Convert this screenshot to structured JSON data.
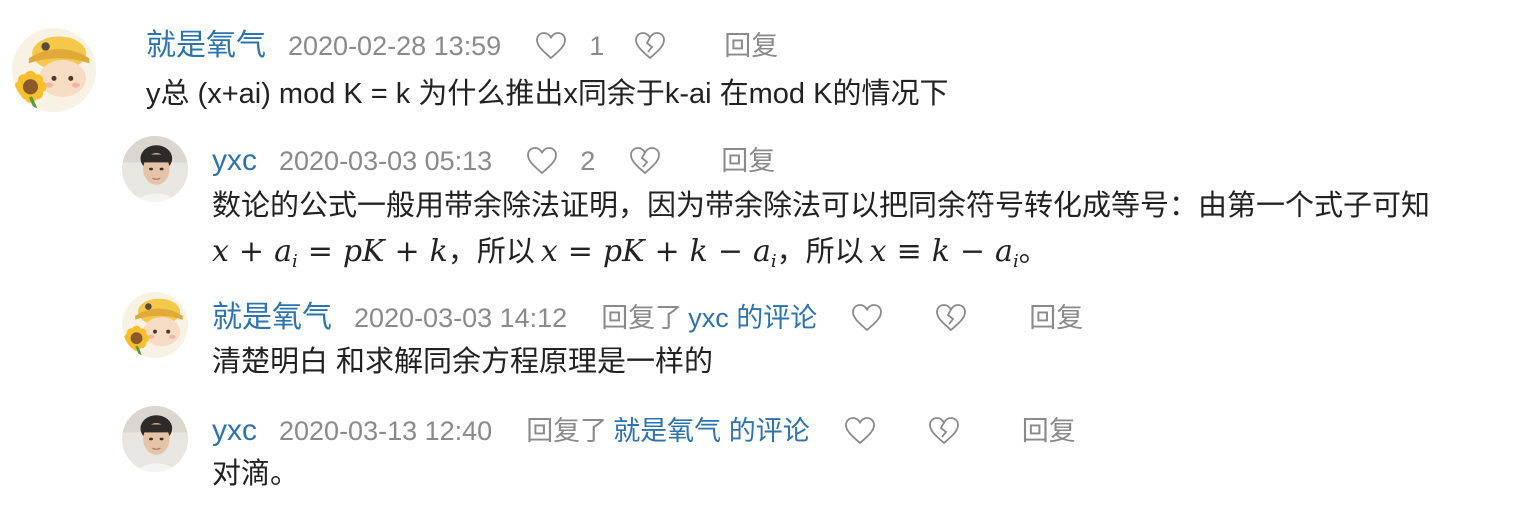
{
  "comments": [
    {
      "username": "就是氧气",
      "time": "2020-02-28 13:59",
      "likes": "1",
      "reply_label": "回复",
      "content": "y总 (x+ai) mod K = k 为什么推出x同余于k-ai 在mod K的情况下",
      "avatar": "sunflower-cartoon-avatar"
    },
    {
      "username": "yxc",
      "time": "2020-03-03 05:13",
      "likes": "2",
      "reply_label": "回复",
      "content_line1": "数论的公式一般用带余除法证明，因为带余除法可以把同余符号转化成等号：由第一个式子可知",
      "content_line2": {
        "part1": "，所以",
        "part2": "，所以",
        "part3": "。"
      },
      "avatar": "person-photo-avatar"
    },
    {
      "username": "就是氧气",
      "time": "2020-03-03 14:12",
      "reply_prefix": "回复了",
      "reply_target": "yxc 的评论",
      "likes": "",
      "reply_label": "回复",
      "content": "清楚明白 和求解同余方程原理是一样的",
      "avatar": "sunflower-cartoon-avatar"
    },
    {
      "username": "yxc",
      "time": "2020-03-13 12:40",
      "reply_prefix": "回复了",
      "reply_target": "就是氧气 的评论",
      "likes": "",
      "reply_label": "回复",
      "content": "对滴。",
      "avatar": "person-photo-avatar"
    }
  ],
  "icons": {
    "like": "heart-outline-icon",
    "dislike": "broken-heart-icon"
  },
  "colors": {
    "username": "#2d73ae",
    "meta": "#8a8a8a",
    "text": "#222222"
  }
}
